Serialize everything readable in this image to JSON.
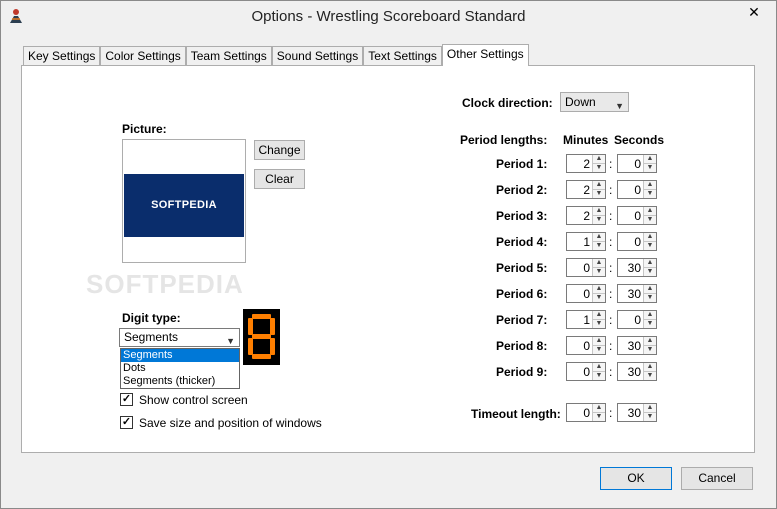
{
  "window": {
    "title": "Options - Wrestling Scoreboard Standard"
  },
  "tabs": [
    {
      "label": "Key Settings"
    },
    {
      "label": "Color Settings"
    },
    {
      "label": "Team Settings"
    },
    {
      "label": "Sound Settings"
    },
    {
      "label": "Text Settings"
    },
    {
      "label": "Other Settings"
    }
  ],
  "picture": {
    "label": "Picture:",
    "image_text": "SOFTPEDIA",
    "change_label": "Change",
    "clear_label": "Clear"
  },
  "digit_type": {
    "label": "Digit type:",
    "selected": "Segments",
    "options": [
      "Segments",
      "Dots",
      "Segments (thicker)"
    ],
    "preview_digit": "8",
    "preview_color": "#ff7f00"
  },
  "checkboxes": [
    {
      "label": "Show control screen",
      "checked": true
    },
    {
      "label": "Save size and position of windows",
      "checked": true
    }
  ],
  "clock": {
    "label": "Clock direction:",
    "value": "Down"
  },
  "periods": {
    "header": "Period lengths:",
    "minutes_header": "Minutes",
    "seconds_header": "Seconds",
    "rows": [
      {
        "label": "Period 1:",
        "minutes": "2",
        "seconds": "0"
      },
      {
        "label": "Period 2:",
        "minutes": "2",
        "seconds": "0"
      },
      {
        "label": "Period 3:",
        "minutes": "2",
        "seconds": "0"
      },
      {
        "label": "Period 4:",
        "minutes": "1",
        "seconds": "0"
      },
      {
        "label": "Period 5:",
        "minutes": "0",
        "seconds": "30"
      },
      {
        "label": "Period 6:",
        "minutes": "0",
        "seconds": "30"
      },
      {
        "label": "Period 7:",
        "minutes": "1",
        "seconds": "0"
      },
      {
        "label": "Period 8:",
        "minutes": "0",
        "seconds": "30"
      },
      {
        "label": "Period 9:",
        "minutes": "0",
        "seconds": "30"
      }
    ],
    "colon": ":"
  },
  "timeout": {
    "label": "Timeout length:",
    "minutes": "0",
    "seconds": "30"
  },
  "footer": {
    "ok_label": "OK",
    "cancel_label": "Cancel"
  },
  "watermark": "SOFTPEDIA"
}
